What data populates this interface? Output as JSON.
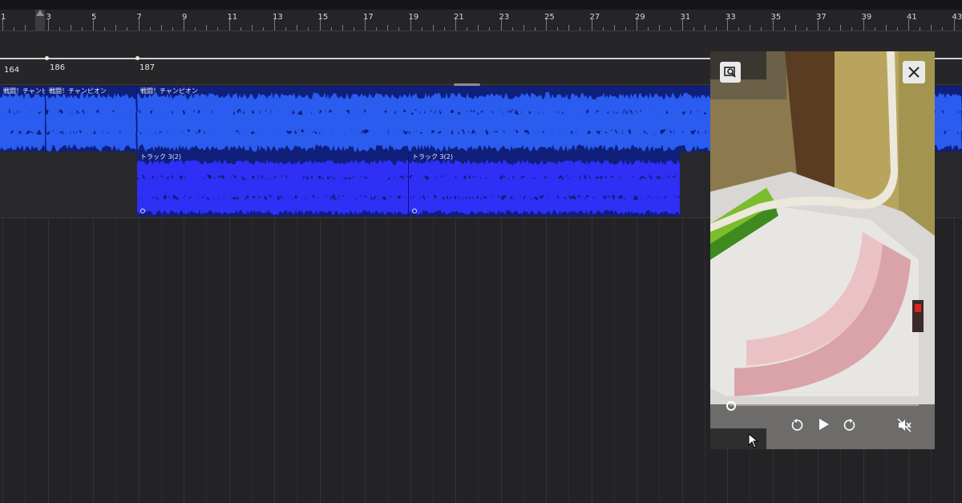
{
  "ruler": {
    "bars": [
      "1",
      "3",
      "5",
      "7",
      "9",
      "11",
      "13",
      "15",
      "17",
      "19",
      "21",
      "23",
      "25",
      "27",
      "29",
      "31",
      "33",
      "35",
      "37",
      "39",
      "41",
      "43"
    ]
  },
  "tempo": {
    "points": [
      "164",
      "186",
      "187"
    ]
  },
  "tracks": {
    "track1": {
      "clips": [
        "戦闘！チャンピ",
        "戦闘！チャンピオン",
        "戦闘！チャンピオン"
      ],
      "color": "#1c36c8"
    },
    "track2": {
      "clips": [
        "トラック 3(2)",
        "トラック 3(2)"
      ],
      "color": "#2323f0"
    }
  },
  "video_popup": {
    "icons": [
      "zoom-icon",
      "close-icon",
      "rewind-icon",
      "play-icon",
      "forward-icon",
      "muted-icon"
    ],
    "progress": 0.0
  }
}
